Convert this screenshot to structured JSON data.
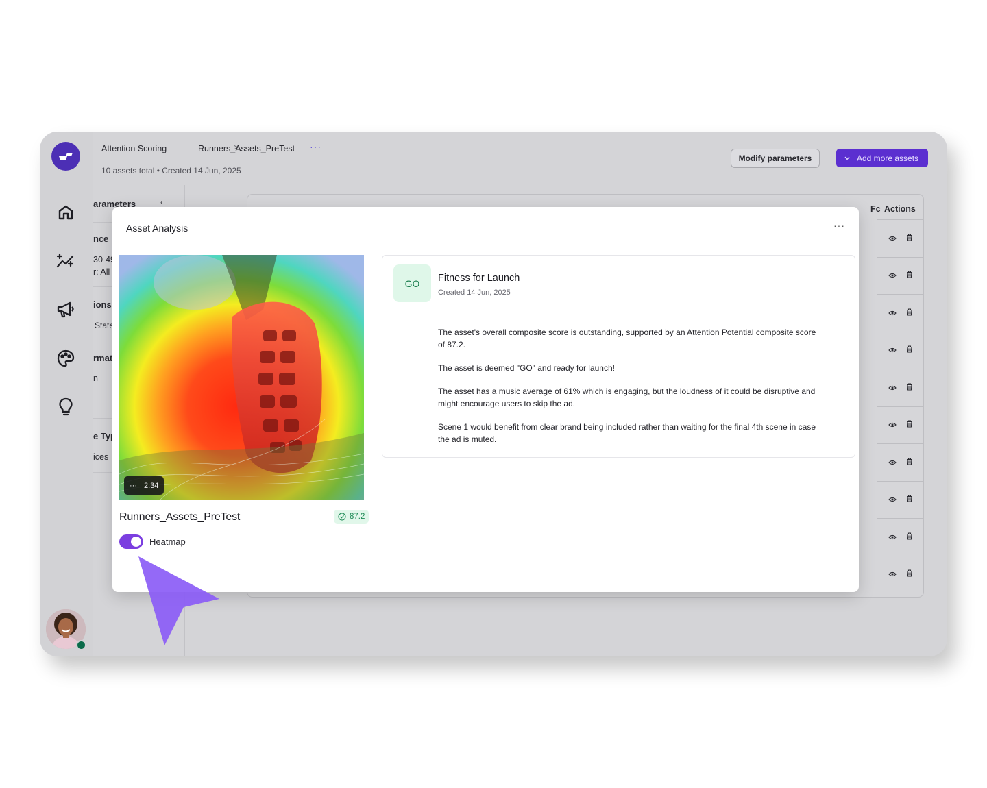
{
  "header": {
    "breadcrumb": [
      "Attention Scoring",
      "Runners_Assets_PreTest"
    ],
    "breadcrumb_separator": ">",
    "more_label": "···",
    "subline": "10 assets total • Created 14 Jun, 2025",
    "modify_button": "Modify parameters",
    "add_button": "Add more assets"
  },
  "sidebar": {
    "icons": [
      "home-icon",
      "sparkle-chart-icon",
      "megaphone-icon",
      "palette-icon",
      "lightbulb-icon"
    ]
  },
  "params_panel": {
    "title": "arameters",
    "lines": [
      "nce",
      "30-49",
      "r:  All",
      "ions",
      "State",
      "rmat",
      "n",
      "e Typ",
      "ices"
    ]
  },
  "table": {
    "header_partial": "Fc",
    "actions_header": "Actions",
    "row_count": 10
  },
  "modal": {
    "title": "Asset Analysis",
    "more_label": "···",
    "asset": {
      "duration": "2:34",
      "duration_prefix": "···",
      "name": "Runners_Assets_PreTest",
      "score": "87.2",
      "toggle_label": "Heatmap",
      "toggle_on": true
    },
    "card": {
      "badge": "GO",
      "title": "Fitness for Launch",
      "date": "Created 14 Jun, 2025",
      "paragraphs": [
        "The asset's overall composite score is outstanding, supported by an Attention Potential composite score of 87.2.",
        "The asset is deemed \"GO\" and ready for launch!",
        "The asset has a music average of 61% which is engaging, but the loudness of it could be disruptive and might encourage users to skip the ad.",
        "Scene 1 would benefit from clear brand being included rather than waiting for the final 4th scene in case the ad is muted."
      ]
    }
  },
  "colors": {
    "accent": "#5b2fd0",
    "toggle": "#7b3ee0",
    "go_badge_bg": "#dff7e9",
    "score_text": "#1d8a55",
    "cursor": "#8b5cf6"
  }
}
